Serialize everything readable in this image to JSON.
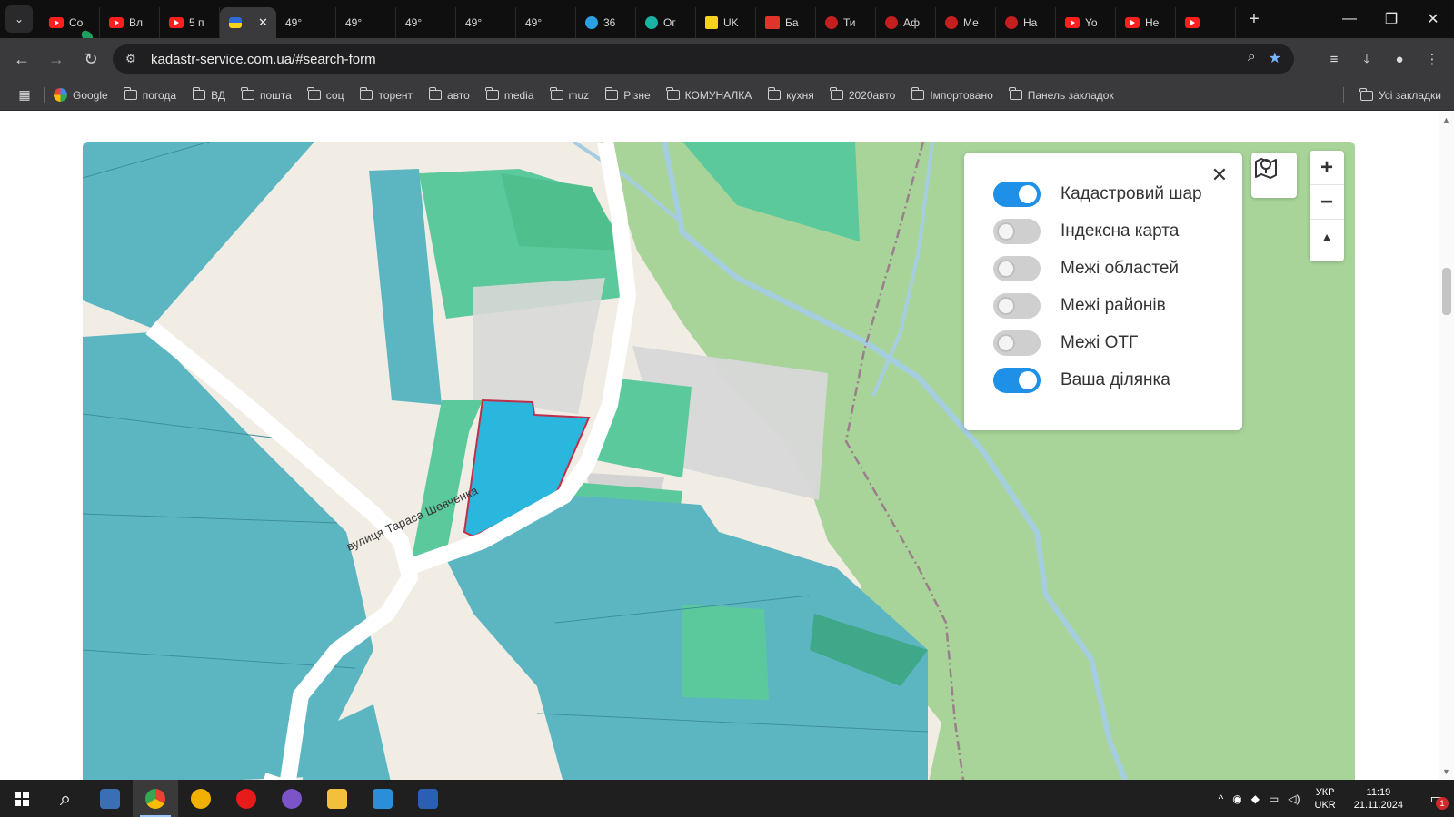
{
  "browser": {
    "tabs": [
      {
        "label": "Co",
        "icon": "youtube-icon"
      },
      {
        "label": "Вл",
        "icon": "youtube-icon"
      },
      {
        "label": "5 п",
        "icon": "youtube-icon"
      },
      {
        "label": "",
        "icon": "ukraine-flag-icon",
        "active": true
      },
      {
        "label": "49°",
        "icon": "maps-pin-icon"
      },
      {
        "label": "49°",
        "icon": "maps-pin-icon"
      },
      {
        "label": "49°",
        "icon": "maps-pin-icon"
      },
      {
        "label": "49°",
        "icon": "maps-pin-icon"
      },
      {
        "label": "49°",
        "icon": "maps-pin-icon"
      },
      {
        "label": "36",
        "icon": "telegram-icon"
      },
      {
        "label": "Ог",
        "icon": "globe-icon"
      },
      {
        "label": "UK",
        "icon": "yellow-square-icon"
      },
      {
        "label": "Ба",
        "icon": "ua-icon"
      },
      {
        "label": "Ти",
        "icon": "red-circle-icon"
      },
      {
        "label": "Аф",
        "icon": "thumb-icon"
      },
      {
        "label": "Ме",
        "icon": "thumb-icon"
      },
      {
        "label": "На",
        "icon": "thumb-icon"
      },
      {
        "label": "Yo",
        "icon": "youtube-icon"
      },
      {
        "label": "Не",
        "icon": "youtube-icon"
      },
      {
        "label": "",
        "icon": "youtube-icon"
      }
    ],
    "url": "kadastr-service.com.ua/#search-form",
    "bookmarks": [
      {
        "label": "Google",
        "type": "google"
      },
      {
        "label": "погода",
        "type": "folder"
      },
      {
        "label": "ВД",
        "type": "folder"
      },
      {
        "label": "пошта",
        "type": "folder"
      },
      {
        "label": "соц",
        "type": "folder"
      },
      {
        "label": "торент",
        "type": "folder"
      },
      {
        "label": "авто",
        "type": "folder"
      },
      {
        "label": "media",
        "type": "folder"
      },
      {
        "label": "muz",
        "type": "folder"
      },
      {
        "label": "Різне",
        "type": "folder"
      },
      {
        "label": "КОМУНАЛКА",
        "type": "folder"
      },
      {
        "label": "кухня",
        "type": "folder"
      },
      {
        "label": "2020авто",
        "type": "folder"
      },
      {
        "label": "Імпортовано",
        "type": "folder"
      },
      {
        "label": "Панель закладок",
        "type": "folder"
      }
    ],
    "all_bookmarks_label": "Усі закладки"
  },
  "map": {
    "street_label": "вулиця Тараса Шевченка",
    "layers": [
      {
        "label": "Кадастровий шар",
        "enabled": true
      },
      {
        "label": "Індексна карта",
        "enabled": false
      },
      {
        "label": "Межі областей",
        "enabled": false
      },
      {
        "label": "Межі районів",
        "enabled": false
      },
      {
        "label": "Межі ОТГ",
        "enabled": false
      },
      {
        "label": "Ваша ділянка",
        "enabled": true
      }
    ],
    "colors": {
      "parcel_teal": "#5cb6c2",
      "parcel_green": "#5cc99d",
      "forest": "#a8d49a",
      "highlight": "#2bb6de",
      "highlight_border": "#c0304a",
      "toggle_on": "#1e90e8"
    }
  },
  "taskbar": {
    "lang_top": "УКР",
    "lang_bottom": "UKR",
    "time": "11:19",
    "date": "21.11.2024",
    "notifications": "1"
  }
}
